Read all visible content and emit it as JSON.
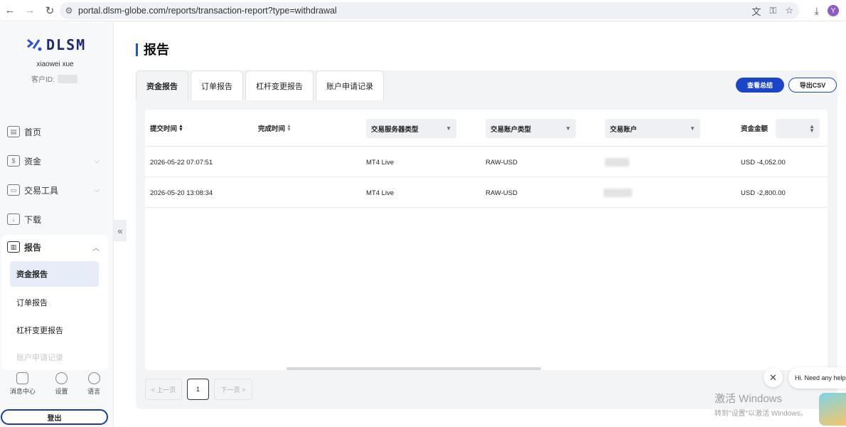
{
  "browser": {
    "url": "portal.dlsm-globe.com/reports/transaction-report?type=withdrawal",
    "avatar_letter": "Y"
  },
  "sidebar": {
    "logo_text": "DLSM",
    "username": "xiaowei xue",
    "client_id_label": "客户ID:",
    "menu": [
      {
        "label": "首页",
        "icon": "home-icon"
      },
      {
        "label": "资金",
        "icon": "wallet-icon"
      },
      {
        "label": "交易工具",
        "icon": "monitor-icon"
      },
      {
        "label": "下载",
        "icon": "download-icon"
      },
      {
        "label": "报告",
        "icon": "report-icon"
      }
    ],
    "report_sub": [
      "资金报告",
      "订单报告",
      "杠杆变更报告",
      "账户申请记录"
    ],
    "bottom": [
      {
        "label": "消息中心",
        "icon": "message-icon"
      },
      {
        "label": "设置",
        "icon": "settings-icon"
      },
      {
        "label": "语言",
        "icon": "globe-icon"
      }
    ],
    "logout": "登出"
  },
  "main": {
    "title": "报告",
    "tabs": [
      "资金报告",
      "订单报告",
      "杠杆变更报告",
      "账户申请记录"
    ],
    "active_tab": 0,
    "view_summary": "查看总结",
    "export_csv": "导出CSV",
    "columns": {
      "submit_time": "提交时间",
      "complete_time": "完成时间",
      "server_type": "交易服务器类型",
      "account_type": "交易账户类型",
      "account": "交易账户",
      "amount": "资金金额"
    },
    "rows": [
      {
        "submit_time": "2026-05-22 07:07:51",
        "complete_time": "",
        "server_type": "MT4 Live",
        "account_type": "RAW-USD",
        "amount": "USD -4,052.00"
      },
      {
        "submit_time": "2026-05-20 13:08:34",
        "complete_time": "",
        "server_type": "MT4 Live",
        "account_type": "RAW-USD",
        "amount": "USD -2,800.00"
      }
    ],
    "pager": {
      "prev": "< 上一页",
      "current": "1",
      "next": "下一页 >"
    }
  },
  "chat": {
    "greeting": "Hi. Need any help?"
  },
  "watermark": {
    "line1": "激活 Windows",
    "line2": "转到\"设置\"以激活 Windows。"
  },
  "colors": {
    "accent": "#1b45c9",
    "sidebar_bg": "#f7f8fa",
    "active_sub_bg": "#e6ecf8"
  }
}
